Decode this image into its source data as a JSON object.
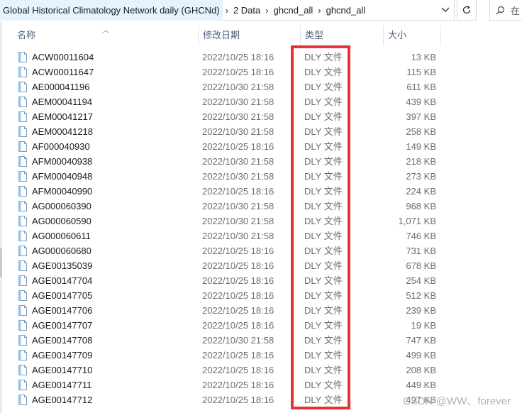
{
  "address_bar": {
    "crumbs": [
      "Global Historical Climatology Network daily (GHCNd)",
      "2 Data",
      "ghcnd_all",
      "ghcnd_all"
    ],
    "separator": "›",
    "dropdown_icon": "chevron-down-icon",
    "refresh_icon": "refresh-icon"
  },
  "search": {
    "icon": "search-icon",
    "placeholder": "在"
  },
  "columns": {
    "name": "名称",
    "date": "修改日期",
    "type": "类型",
    "size": "大小"
  },
  "files": [
    {
      "name": "ACW00011604",
      "date": "2022/10/25 18:16",
      "type": "DLY 文件",
      "size": "13 KB"
    },
    {
      "name": "ACW00011647",
      "date": "2022/10/25 18:16",
      "type": "DLY 文件",
      "size": "115 KB"
    },
    {
      "name": "AE000041196",
      "date": "2022/10/30 21:58",
      "type": "DLY 文件",
      "size": "611 KB"
    },
    {
      "name": "AEM00041194",
      "date": "2022/10/30 21:58",
      "type": "DLY 文件",
      "size": "439 KB"
    },
    {
      "name": "AEM00041217",
      "date": "2022/10/30 21:58",
      "type": "DLY 文件",
      "size": "397 KB"
    },
    {
      "name": "AEM00041218",
      "date": "2022/10/30 21:58",
      "type": "DLY 文件",
      "size": "258 KB"
    },
    {
      "name": "AF000040930",
      "date": "2022/10/25 18:16",
      "type": "DLY 文件",
      "size": "149 KB"
    },
    {
      "name": "AFM00040938",
      "date": "2022/10/30 21:58",
      "type": "DLY 文件",
      "size": "218 KB"
    },
    {
      "name": "AFM00040948",
      "date": "2022/10/30 21:58",
      "type": "DLY 文件",
      "size": "273 KB"
    },
    {
      "name": "AFM00040990",
      "date": "2022/10/25 18:16",
      "type": "DLY 文件",
      "size": "224 KB"
    },
    {
      "name": "AG000060390",
      "date": "2022/10/30 21:58",
      "type": "DLY 文件",
      "size": "968 KB"
    },
    {
      "name": "AG000060590",
      "date": "2022/10/30 21:58",
      "type": "DLY 文件",
      "size": "1,071 KB"
    },
    {
      "name": "AG000060611",
      "date": "2022/10/30 21:58",
      "type": "DLY 文件",
      "size": "746 KB"
    },
    {
      "name": "AG000060680",
      "date": "2022/10/25 18:16",
      "type": "DLY 文件",
      "size": "731 KB"
    },
    {
      "name": "AGE00135039",
      "date": "2022/10/25 18:16",
      "type": "DLY 文件",
      "size": "678 KB"
    },
    {
      "name": "AGE00147704",
      "date": "2022/10/25 18:16",
      "type": "DLY 文件",
      "size": "254 KB"
    },
    {
      "name": "AGE00147705",
      "date": "2022/10/25 18:16",
      "type": "DLY 文件",
      "size": "512 KB"
    },
    {
      "name": "AGE00147706",
      "date": "2022/10/25 18:16",
      "type": "DLY 文件",
      "size": "239 KB"
    },
    {
      "name": "AGE00147707",
      "date": "2022/10/25 18:16",
      "type": "DLY 文件",
      "size": "19 KB"
    },
    {
      "name": "AGE00147708",
      "date": "2022/10/30 21:58",
      "type": "DLY 文件",
      "size": "747 KB"
    },
    {
      "name": "AGE00147709",
      "date": "2022/10/25 18:16",
      "type": "DLY 文件",
      "size": "499 KB"
    },
    {
      "name": "AGE00147710",
      "date": "2022/10/25 18:16",
      "type": "DLY 文件",
      "size": "208 KB"
    },
    {
      "name": "AGE00147711",
      "date": "2022/10/25 18:16",
      "type": "DLY 文件",
      "size": "449 KB"
    },
    {
      "name": "AGE00147712",
      "date": "2022/10/25 18:16",
      "type": "DLY 文件",
      "size": "497 KB"
    }
  ],
  "annotation_color": "#e53232",
  "watermark": "CSDN @WW、forever"
}
